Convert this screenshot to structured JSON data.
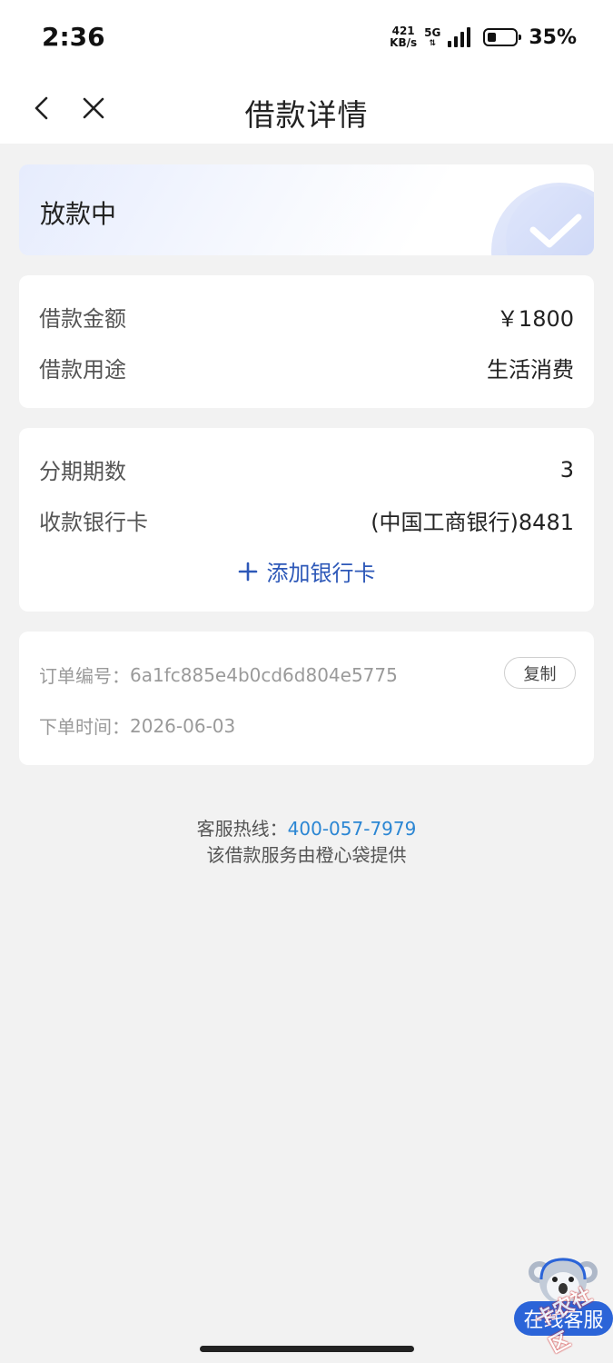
{
  "status_bar": {
    "time": "2:36",
    "net_speed_value": "421",
    "net_speed_unit": "KB/s",
    "network_type": "5G",
    "battery_percent": "35%",
    "battery_level": 0.35
  },
  "nav": {
    "title": "借款详情",
    "back_icon": "chevron-left-icon",
    "close_icon": "close-icon"
  },
  "status_card": {
    "text": "放款中",
    "icon": "check-circle-icon"
  },
  "loan": {
    "amount_label": "借款金额",
    "amount_value": "￥1800",
    "purpose_label": "借款用途",
    "purpose_value": "生活消费"
  },
  "installment": {
    "periods_label": "分期期数",
    "periods_value": "3",
    "bank_label": "收款银行卡",
    "bank_value": "(中国工商银行)8481",
    "add_card_label": "添加银行卡"
  },
  "order": {
    "number_label": "订单编号：",
    "number_value": "6a1fc885e4b0cd6d804e5775",
    "copy_label": "复制",
    "time_label": "下单时间：",
    "time_value": "2026-06-03"
  },
  "footer": {
    "hotline_label": "客服热线：",
    "hotline_number": "400-057-7979",
    "provider_text": "该借款服务由橙心袋提供"
  },
  "customer_service": {
    "label": "在线客服"
  },
  "watermark": {
    "text": "卡农社区"
  },
  "colors": {
    "accent": "#2d58b8",
    "link": "#2b86d3",
    "page_bg": "#f2f2f2"
  }
}
